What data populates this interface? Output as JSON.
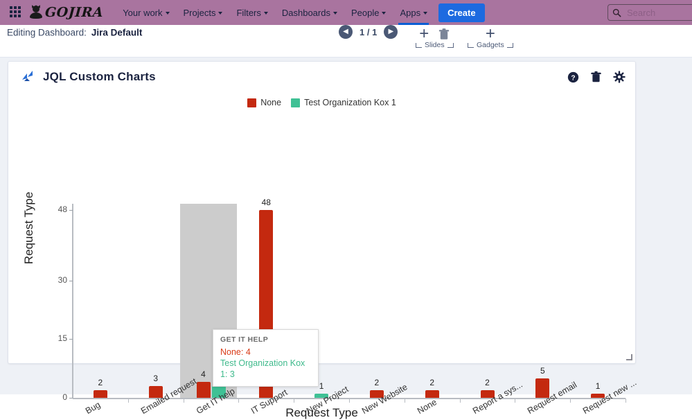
{
  "topnav": {
    "app_switcher_icon": "grid-apps-icon",
    "logo_text": "GOJIRA",
    "logo_icon": "gojira-creature-icon",
    "items": [
      {
        "label": "Your work",
        "has_caret": true,
        "active": false
      },
      {
        "label": "Projects",
        "has_caret": true,
        "active": false
      },
      {
        "label": "Filters",
        "has_caret": true,
        "active": false
      },
      {
        "label": "Dashboards",
        "has_caret": true,
        "active": false
      },
      {
        "label": "People",
        "has_caret": true,
        "active": false
      },
      {
        "label": "Apps",
        "has_caret": true,
        "active": true
      }
    ],
    "create_label": "Create",
    "search_placeholder": "Search",
    "search_value": "",
    "search_icon": "search-icon",
    "bg_color": "#a9749f",
    "accent_color": "#1d6ae0"
  },
  "editbar": {
    "prefix": "Editing Dashboard:",
    "dashboard_name": "Jira Default",
    "prev_icon": "chevron-left-icon",
    "next_icon": "chevron-right-icon",
    "page_indicator": "1 / 1",
    "slides": {
      "add_label": "+",
      "delete_icon": "trash-icon",
      "caption": "Slides"
    },
    "gadgets": {
      "add_label": "+",
      "caption": "Gadgets"
    }
  },
  "panel": {
    "title": "JQL Custom Charts",
    "logo_icon": "jql-charts-logo-icon",
    "actions": [
      {
        "name": "help-icon",
        "label": "?"
      },
      {
        "name": "trash-icon",
        "label": ""
      },
      {
        "name": "gear-icon",
        "label": ""
      }
    ],
    "resize_handle_icon": "resize-handle-icon"
  },
  "tooltip": {
    "title": "GET IT HELP",
    "rows": [
      {
        "text": "None: 4",
        "color": "#d93d1a"
      },
      {
        "text": "Test Organization Kox 1: 3",
        "color": "#3fba8c"
      }
    ]
  },
  "chart_data": {
    "type": "bar",
    "title": "",
    "xlabel": "Request Type",
    "ylabel": "Request Type",
    "ylim": [
      0,
      53
    ],
    "yticks": [
      0,
      15,
      30,
      48
    ],
    "grid": false,
    "legend_position": "top-center",
    "stacked": false,
    "colors": {
      "None": "#c4290f",
      "Test Organization Kox 1": "#3fc195"
    },
    "categories": [
      "Bug",
      "Emailed request",
      "Get IT help",
      "IT Support",
      "New Project",
      "New Website",
      "None",
      "Report a sys...",
      "Request email",
      "Request new ..."
    ],
    "series": [
      {
        "name": "None",
        "color": "#c4290f",
        "values": [
          2,
          3,
          4,
          48,
          null,
          2,
          2,
          2,
          5,
          1
        ]
      },
      {
        "name": "Test Organization Kox 1",
        "color": "#3fc195",
        "values": [
          null,
          null,
          3,
          null,
          1,
          null,
          null,
          null,
          null,
          null
        ]
      }
    ],
    "data_labels": [
      {
        "category": "Bug",
        "series": "None",
        "value": 2
      },
      {
        "category": "Emailed request",
        "series": "None",
        "value": 3
      },
      {
        "category": "Get IT help",
        "series": "None",
        "value": 4
      },
      {
        "category": "Get IT help",
        "series": "Test Organization Kox 1",
        "value": 3
      },
      {
        "category": "IT Support",
        "series": "None",
        "value": 48
      },
      {
        "category": "New Project",
        "series": "Test Organization Kox 1",
        "value": 1
      },
      {
        "category": "New Website",
        "series": "None",
        "value": 2
      },
      {
        "category": "None",
        "series": "None",
        "value": 2
      },
      {
        "category": "Report a sys...",
        "series": "None",
        "value": 2
      },
      {
        "category": "Request email",
        "series": "None",
        "value": 5
      },
      {
        "category": "Request new ...",
        "series": "None",
        "value": 1
      }
    ],
    "highlighted_category": "Get IT help",
    "highlight_color": "#cccccc"
  }
}
